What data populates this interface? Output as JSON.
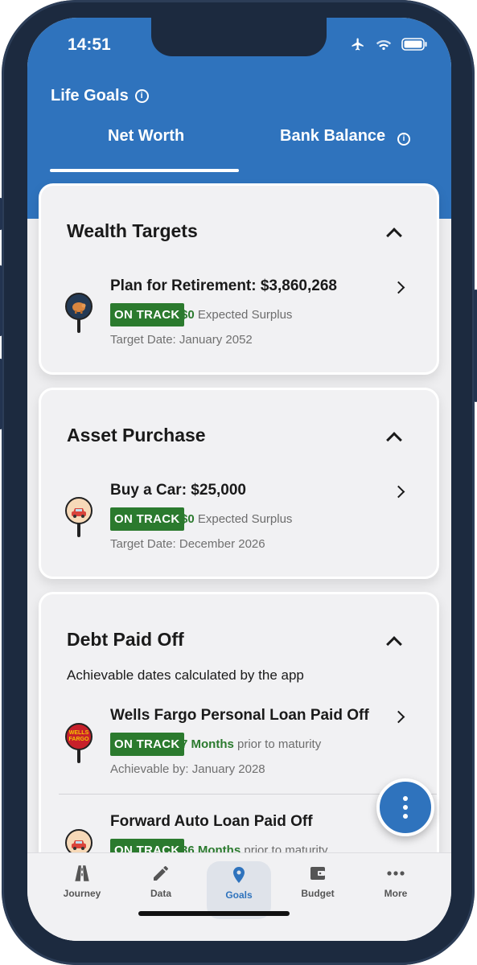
{
  "status_bar": {
    "time": "14:51"
  },
  "header": {
    "title": "Life Goals",
    "tabs": [
      {
        "label": "Net Worth",
        "active": true
      },
      {
        "label": "Bank Balance",
        "active": false
      }
    ]
  },
  "colors": {
    "brand_blue": "#2f73bd",
    "on_track_green": "#2b7a2e"
  },
  "sections": [
    {
      "title": "Wealth Targets",
      "goals": [
        {
          "title": "Plan for Retirement: $3,860,268",
          "badge": "ON TRACK",
          "amount": "$0",
          "amount_suffix": " Expected Surplus",
          "date_line": "Target Date: January 2052",
          "icon": "piggy-bank-icon"
        }
      ]
    },
    {
      "title": "Asset Purchase",
      "goals": [
        {
          "title": "Buy a Car: $25,000",
          "badge": "ON TRACK",
          "amount": "$0",
          "amount_suffix": " Expected Surplus",
          "date_line": "Target Date: December 2026",
          "icon": "car-icon"
        }
      ]
    },
    {
      "title": "Debt Paid Off",
      "subtitle": "Achievable dates calculated by the app",
      "goals": [
        {
          "title": "Wells Fargo Personal Loan Paid Off",
          "badge": "ON TRACK",
          "amount": "7 Months",
          "amount_suffix": " prior to maturity",
          "date_line": "Achievable by: January 2028",
          "icon": "wells-fargo-logo-icon",
          "logo_text_1": "WELLS",
          "logo_text_2": "FARGO"
        },
        {
          "title": "Forward Auto Loan Paid Off",
          "badge": "ON TRACK",
          "amount": "36 Months",
          "amount_suffix": " prior to maturity",
          "icon": "car-icon"
        }
      ]
    }
  ],
  "bottom_nav": [
    {
      "label": "Journey",
      "icon": "road-icon"
    },
    {
      "label": "Data",
      "icon": "pencil-icon"
    },
    {
      "label": "Goals",
      "icon": "location-pin-icon",
      "active": true
    },
    {
      "label": "Budget",
      "icon": "wallet-icon"
    },
    {
      "label": "More",
      "icon": "more-horizontal-icon"
    }
  ]
}
